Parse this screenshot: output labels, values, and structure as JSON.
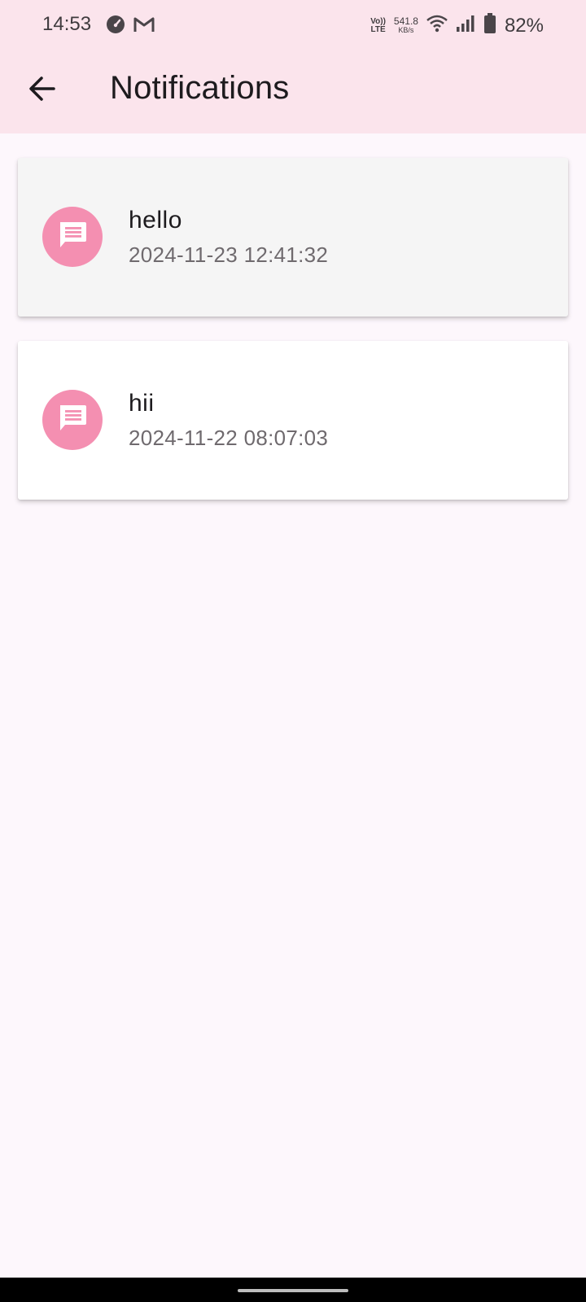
{
  "status_bar": {
    "time": "14:53",
    "volte_top": "Vo))",
    "volte_bottom": "LTE",
    "net_speed": "541.8",
    "net_speed_unit": "KB/s",
    "battery_percent": "82%"
  },
  "app_bar": {
    "title": "Notifications",
    "back_icon": "arrow-back-icon"
  },
  "notifications": [
    {
      "title": "hello",
      "timestamp": "2024-11-23 12:41:32",
      "icon": "message-icon"
    },
    {
      "title": "hii",
      "timestamp": "2024-11-22 08:07:03",
      "icon": "message-icon"
    }
  ],
  "colors": {
    "app_bar_bg": "#fbe4ec",
    "page_bg": "#fdf7fc",
    "avatar_bg": "#f48fb1"
  }
}
